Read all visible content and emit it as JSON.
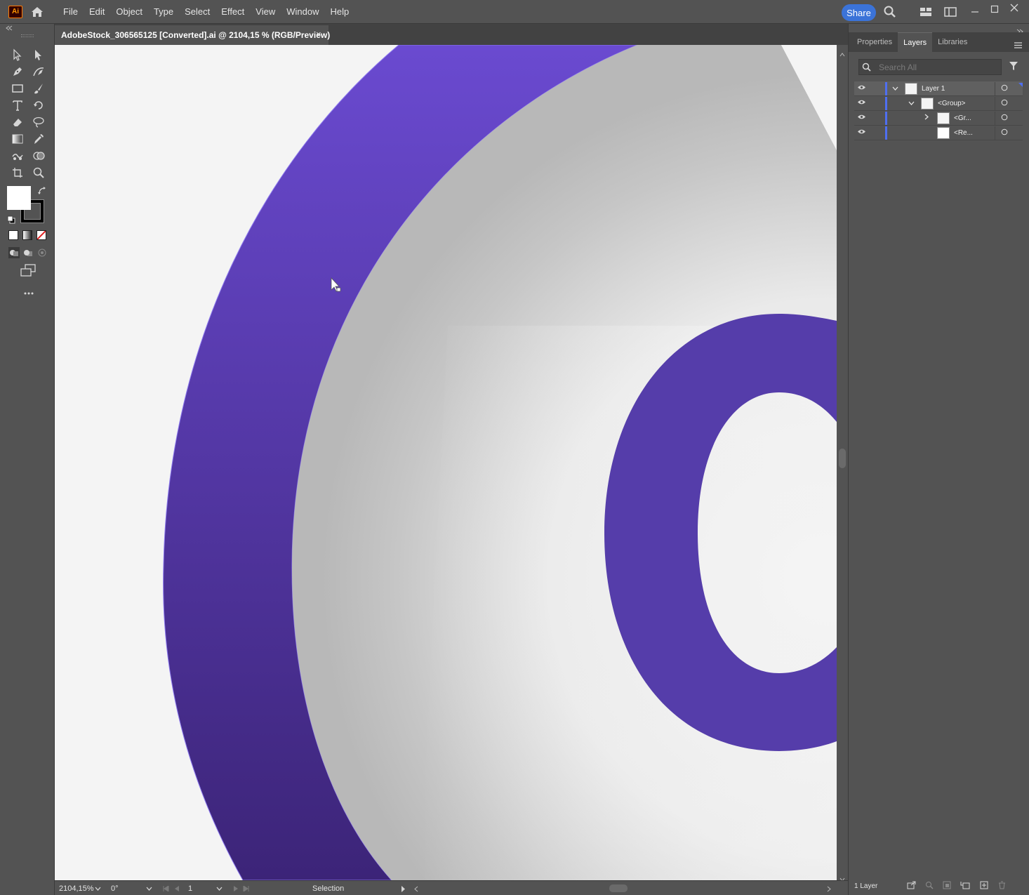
{
  "app": {
    "logo_text": "Ai",
    "menu": [
      "File",
      "Edit",
      "Object",
      "Type",
      "Select",
      "Effect",
      "View",
      "Window",
      "Help"
    ],
    "share_label": "Share"
  },
  "document": {
    "tab_title": "AdobeStock_306565125 [Converted].ai @ 2104,15 % (RGB/Preview)",
    "close_glyph": "×"
  },
  "artwork": {
    "ring_color_top": "#6a4ad0",
    "ring_color_bottom": "#3c2478",
    "letter_color": "#553daa",
    "background_color": "#f4f4f4"
  },
  "status": {
    "zoom": "2104,15%",
    "rotation": "0°",
    "artboard": "1",
    "tool": "Selection"
  },
  "panel": {
    "tabs": [
      "Properties",
      "Layers",
      "Libraries"
    ],
    "active_tab": "Layers",
    "search_placeholder": "Search All",
    "layers": [
      {
        "name": "Layer 1"
      },
      {
        "name": "<Group>"
      },
      {
        "name": "<Gr..."
      },
      {
        "name": "<Re..."
      }
    ],
    "footer_count": "1 Layer"
  }
}
